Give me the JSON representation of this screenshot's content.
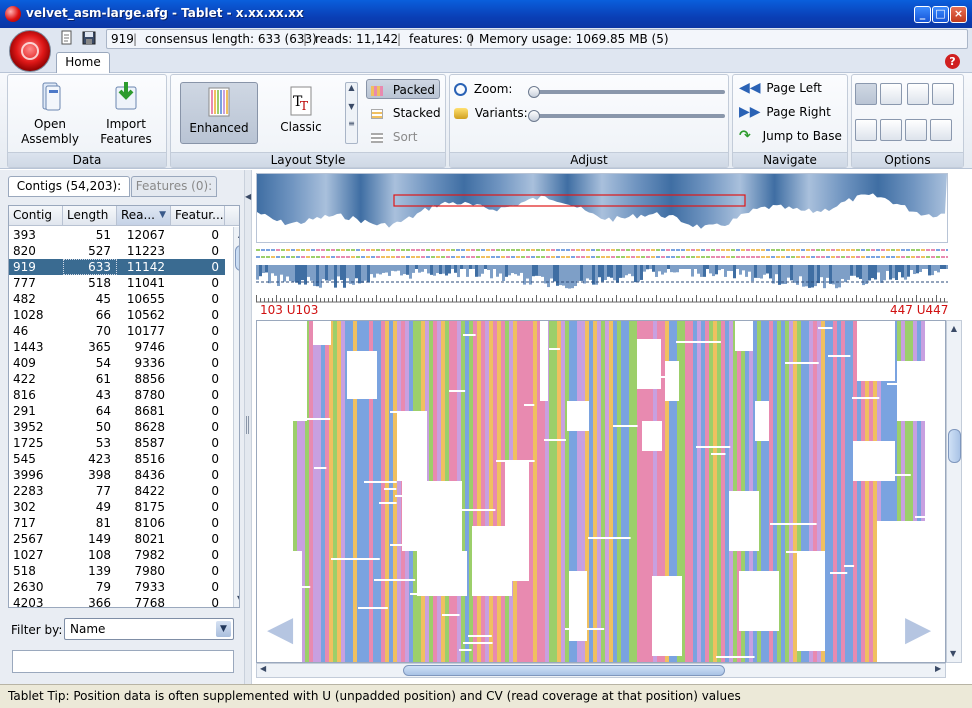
{
  "window": {
    "title": "velvet_asm-large.afg - Tablet - x.xx.xx.xx"
  },
  "status_line": {
    "contig": "919",
    "consensus": "consensus length: 633 (633)",
    "reads": "reads: 11,142",
    "features": "features: 0",
    "memory": "Memory usage: 1069.85 MB (5)"
  },
  "tabs": {
    "home": "Home"
  },
  "ribbon": {
    "data": {
      "label": "Data",
      "open": [
        "Open",
        "Assembly"
      ],
      "import": [
        "Import",
        "Features"
      ]
    },
    "layout": {
      "label": "Layout Style",
      "enhanced": "Enhanced",
      "classic": "Classic",
      "packed": "Packed",
      "stacked": "Stacked",
      "sort": "Sort"
    },
    "adjust": {
      "label": "Adjust",
      "zoom": "Zoom:",
      "variants": "Variants:",
      "zoom_level": 0.0,
      "variants_level": 0.0
    },
    "navigate": {
      "label": "Navigate",
      "page_left": "Page Left",
      "page_right": "Page Right",
      "jump": "Jump to Base"
    },
    "options": {
      "label": "Options"
    }
  },
  "left_panel": {
    "contigs_tab": "Contigs (54,203):",
    "features_tab": "Features (0):",
    "columns": [
      "Contig",
      "Length",
      "Rea...",
      "Featur..."
    ],
    "rows": [
      [
        "393",
        "51",
        "12067",
        "0"
      ],
      [
        "820",
        "527",
        "11223",
        "0"
      ],
      [
        "919",
        "633",
        "11142",
        "0"
      ],
      [
        "777",
        "518",
        "11041",
        "0"
      ],
      [
        "482",
        "45",
        "10655",
        "0"
      ],
      [
        "1028",
        "66",
        "10562",
        "0"
      ],
      [
        "46",
        "70",
        "10177",
        "0"
      ],
      [
        "1443",
        "365",
        "9746",
        "0"
      ],
      [
        "409",
        "54",
        "9336",
        "0"
      ],
      [
        "422",
        "61",
        "8856",
        "0"
      ],
      [
        "816",
        "43",
        "8780",
        "0"
      ],
      [
        "291",
        "64",
        "8681",
        "0"
      ],
      [
        "3952",
        "50",
        "8628",
        "0"
      ],
      [
        "1725",
        "53",
        "8587",
        "0"
      ],
      [
        "545",
        "423",
        "8516",
        "0"
      ],
      [
        "3996",
        "398",
        "8436",
        "0"
      ],
      [
        "2283",
        "77",
        "8422",
        "0"
      ],
      [
        "302",
        "49",
        "8175",
        "0"
      ],
      [
        "717",
        "81",
        "8106",
        "0"
      ],
      [
        "2567",
        "149",
        "8021",
        "0"
      ],
      [
        "1027",
        "108",
        "7982",
        "0"
      ],
      [
        "518",
        "139",
        "7980",
        "0"
      ],
      [
        "2630",
        "79",
        "7933",
        "0"
      ],
      [
        "4203",
        "366",
        "7768",
        "0"
      ]
    ],
    "selected_row": 2,
    "filter_label": "Filter by:",
    "filter_value": "Name",
    "filter_text": ""
  },
  "viewer": {
    "left_position": "103 U103",
    "right_position": "447 U447",
    "base_colors": [
      "#e88ab0",
      "#f0c060",
      "#9ccf6a",
      "#7aa3e0",
      "#c8a0e0",
      "#b8c8d8"
    ]
  },
  "status_bar": {
    "tip": "Tablet Tip: Position data is often supplemented with U (unpadded position) and CV (read coverage at that position) values"
  }
}
